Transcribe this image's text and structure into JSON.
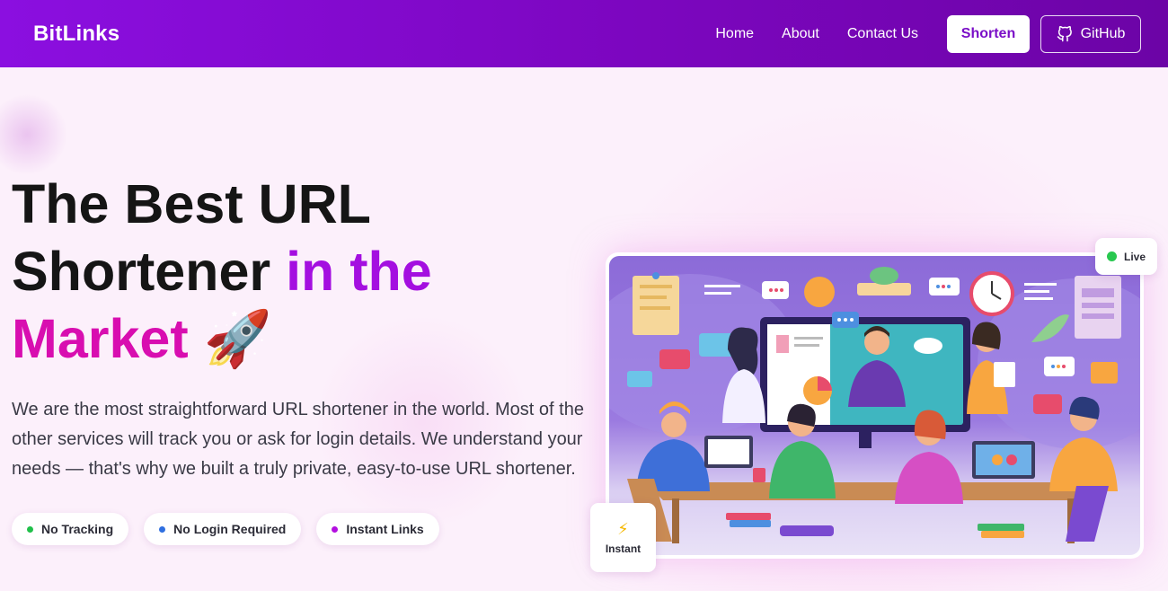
{
  "navbar": {
    "brand": "BitLinks",
    "links": [
      {
        "label": "Home"
      },
      {
        "label": "About"
      },
      {
        "label": "Contact Us"
      }
    ],
    "shorten_label": "Shorten",
    "github_label": "GitHub",
    "background_color": "#7c06bf"
  },
  "hero": {
    "title_line1": "The Best URL",
    "title_line2_plain": "Shortener ",
    "title_line2_accent": "in the",
    "title_line3_accent": "Market",
    "title_emoji": "🚀",
    "description": "We are the most straightforward URL shortener in the world. Most of the other services will track you or ask for login details. We understand your needs — that's why we built a truly private, easy-to-use URL shortener.",
    "accent_colors": [
      "#a40fe0",
      "#d80eb0"
    ]
  },
  "features": [
    {
      "label": "No Tracking",
      "dot_color": "#20c04a"
    },
    {
      "label": "No Login Required",
      "dot_color": "#2f6fe0"
    },
    {
      "label": "Instant Links",
      "dot_color": "#b30fe0"
    }
  ],
  "illustration": {
    "icon": "team-meeting-illustration",
    "live_badge": "Live",
    "live_dot_color": "#28c84f",
    "instant_badge": "Instant",
    "instant_icon": "lightning-icon"
  }
}
